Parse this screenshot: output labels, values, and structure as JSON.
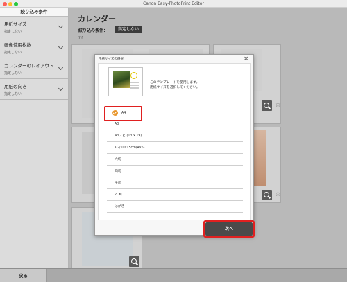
{
  "window": {
    "title": "Canon Easy-PhotoPrint Editor"
  },
  "sidebar": {
    "heading": "絞り込み条件",
    "filters": [
      {
        "label": "用紙サイズ",
        "value": "指定しない"
      },
      {
        "label": "画像使用枚数",
        "value": "指定しない"
      },
      {
        "label": "カレンダーのレイアウト",
        "value": "指定しない"
      },
      {
        "label": "用紙の向き",
        "value": "指定しない"
      }
    ]
  },
  "main": {
    "title": "カレンダー",
    "condition_label": "絞り込み条件：",
    "condition_value": "指定しない",
    "count": "7点"
  },
  "dialog": {
    "title": "用紙サイズの選択",
    "message_line1": "このテンプレートを使用します。",
    "message_line2": "用紙サイズを選択してください。",
    "options": [
      "A4",
      "A3",
      "A3ノビ (13 x 19)",
      "KG/10x15cm(4x6)",
      "六切",
      "四切",
      "半切",
      "2L判",
      "はがき"
    ],
    "selected_option": "A4",
    "next_label": "次へ"
  },
  "bottom": {
    "back_label": "戻る"
  },
  "colors": {
    "accent_check": "#e8962a",
    "highlight": "#e02020",
    "primary_button": "#4a4a4a"
  },
  "icons": {
    "close": "close-icon",
    "chevron": "chevron-down-icon",
    "zoom": "zoom-icon",
    "favorite": "star-icon",
    "check": "check-icon"
  }
}
